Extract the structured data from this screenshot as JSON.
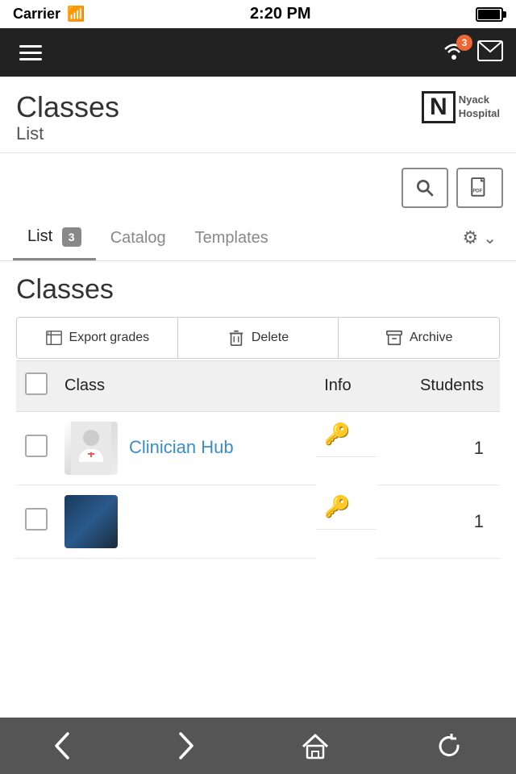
{
  "statusBar": {
    "carrier": "Carrier",
    "time": "2:20 PM"
  },
  "navBar": {
    "notificationCount": "3"
  },
  "pageHeader": {
    "title": "Classes",
    "subtitle": "List",
    "hospitalName": "Nyack\nHospital",
    "hospitalInitial": "N"
  },
  "toolbar": {
    "searchLabel": "search",
    "pdfLabel": "PDF"
  },
  "tabs": {
    "list": {
      "label": "List",
      "badge": "3"
    },
    "catalog": {
      "label": "Catalog"
    },
    "templates": {
      "label": "Templates"
    }
  },
  "classesSection": {
    "heading": "Classes"
  },
  "actionButtons": {
    "exportGrades": "Export grades",
    "delete": "Delete",
    "archive": "Archive"
  },
  "tableHeaders": {
    "class": "Class",
    "info": "Info",
    "students": "Students"
  },
  "classes": [
    {
      "id": 1,
      "name": "Clinician Hub",
      "students": "1",
      "hasKey": true
    },
    {
      "id": 2,
      "name": "",
      "students": "1",
      "hasKey": true
    }
  ]
}
